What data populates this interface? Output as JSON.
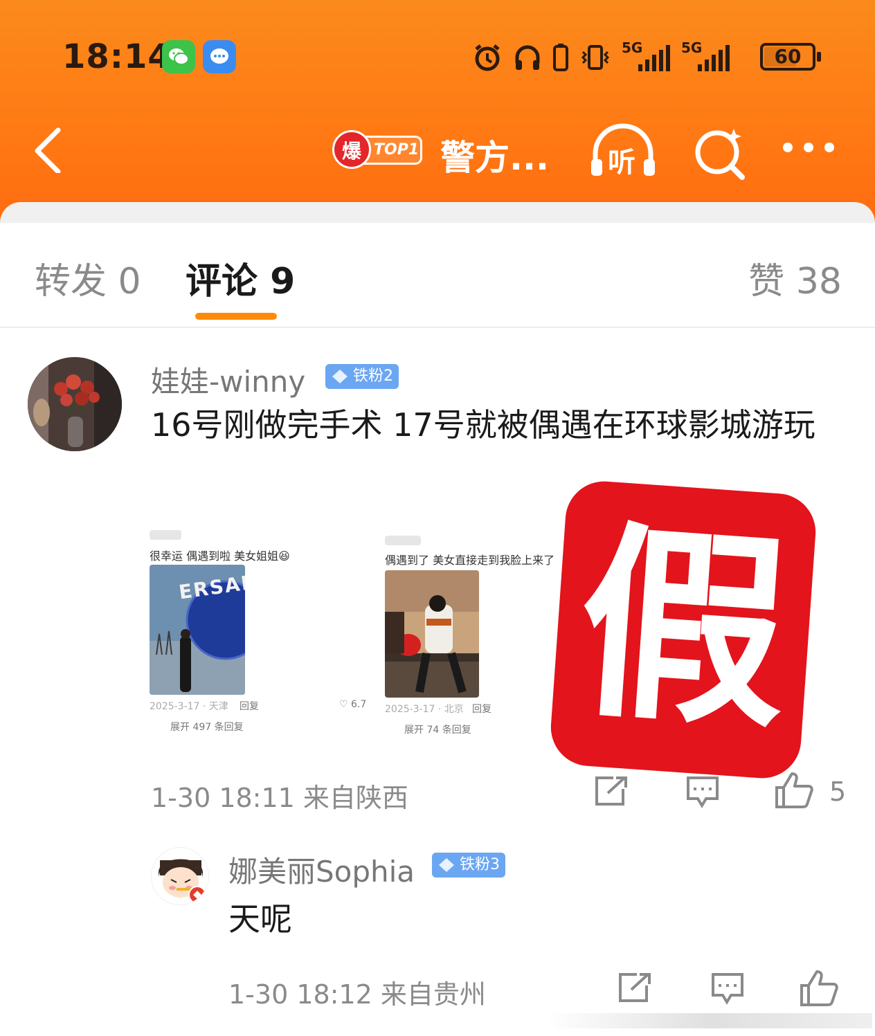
{
  "status_bar": {
    "time": "18:14",
    "network_1": "5G",
    "network_2": "5G",
    "battery": "60",
    "icons": [
      "wechat-icon",
      "message-icon",
      "alarm-icon",
      "headphones-icon",
      "battery-saver-icon",
      "vibrate-icon",
      "signal-icon",
      "signal-icon",
      "battery-icon"
    ]
  },
  "nav": {
    "hot_badge_char": "爆",
    "hot_badge_label": "TOP1",
    "title": "警方...",
    "listen_label": "听",
    "icons": [
      "back-icon",
      "listen-icon",
      "search-icon",
      "more-icon"
    ]
  },
  "tabs": {
    "repost": "转发 0",
    "comment": "评论 9",
    "like": "赞 38"
  },
  "comments": [
    {
      "username": "娃娃-winny",
      "badge": "铁粉2",
      "text": "16号刚做完手术 17号就被偶遇在环球影城游玩",
      "meta": "1-30 18:11 来自陕西",
      "like_count": "5",
      "screenshots": [
        {
          "caption": "很幸运 偶遇到啦 美女姐姐😆",
          "photo_text": "ERSAL",
          "meta": "2025-3-17 · 天津",
          "reply": "回复",
          "expand": "展开 497 条回复"
        },
        {
          "caption": "偶遇到了 美女直接走到我脸上来了",
          "meta": "2025-3-17 · 北京",
          "reply": "回复",
          "expand": "展开 74 条回复",
          "side_like": "6.7"
        }
      ],
      "stamp": "假"
    },
    {
      "username": "娜美丽Sophia",
      "badge": "铁粉3",
      "text": "天呢",
      "meta": "1-30 18:12 来自贵州"
    }
  ],
  "colors": {
    "header_orange": "#ff7a14",
    "tab_indicator": "#ff8a0a",
    "badge_blue": "#6ba6f2",
    "stamp_red": "#e3141c"
  }
}
